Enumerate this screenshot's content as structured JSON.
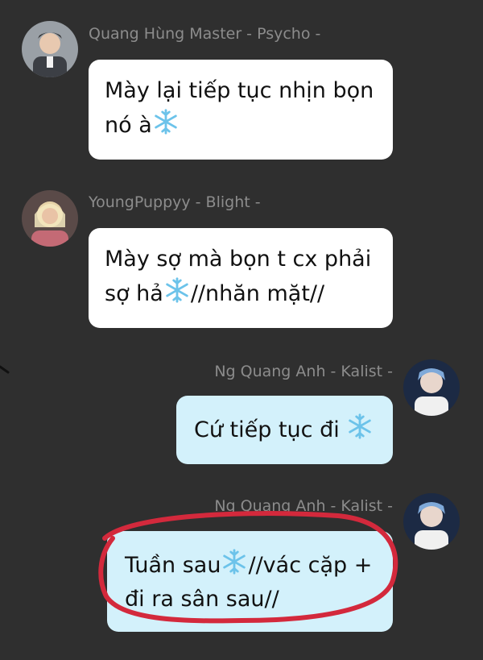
{
  "messages": [
    {
      "sender": "Quang Hùng Master - Psycho -",
      "line1_a": "Mày lại tiếp tục nhịn bọn",
      "line2_a": "nó à",
      "line2_b": ""
    },
    {
      "sender": "YoungPuppyy - Blight -",
      "line1_a": "Mày sợ mà bọn t cx phải",
      "line2_a": "sợ hả",
      "line2_b": "//nhăn mặt//"
    },
    {
      "sender": "Ng Quang Anh - Kalist -",
      "line1_a": "Cứ tiếp tục đi ",
      "line1_b": ""
    },
    {
      "sender": "Ng Quang Anh - Kalist -",
      "line1_a": "Tuần sau",
      "line1_b": "//vác cặp +",
      "line2_a": "đi ra sân sau//"
    }
  ],
  "icons": {
    "emoji": "snowflake-icon"
  },
  "colors": {
    "background": "#2f2f2f",
    "incoming_bubble": "#ffffff",
    "outgoing_bubble": "#d3f1fb",
    "sender_text": "#8c8c8c",
    "highlight_circle": "#d3293c"
  }
}
